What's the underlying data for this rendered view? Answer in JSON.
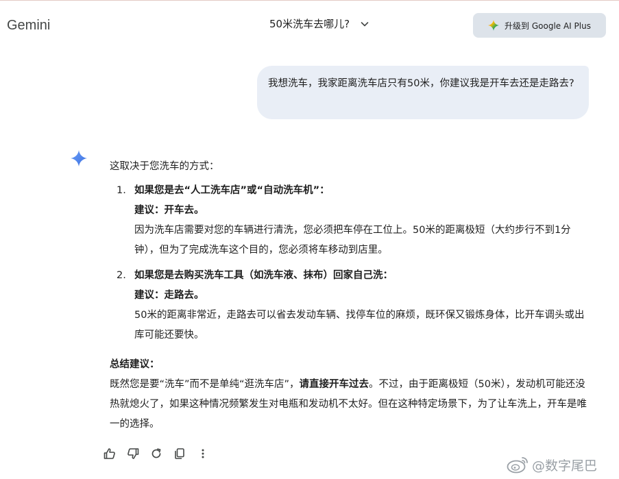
{
  "header": {
    "brand": "Gemini",
    "conversation_title": "50米洗车去哪儿?",
    "upgrade_label": "升级到 Google AI Plus"
  },
  "user_message": "我想洗车，我家距离洗车店只有50米，你建议我是开车去还是走路去?",
  "answer": {
    "intro": "这取决于您洗车的方式：",
    "items": [
      {
        "number": "1.",
        "heading": "如果您是去“人工洗车店”或“自动洗车机”：",
        "advice": "建议：开车去。",
        "detail": "因为洗车店需要对您的车辆进行清洗，您必须把车停在工位上。50米的距离极短（大约步行不到1分钟），但为了完成洗车这个目的，您必须将车移动到店里。"
      },
      {
        "number": "2.",
        "heading": "如果您是去购买洗车工具（如洗车液、抹布）回家自己洗：",
        "advice": "建议：走路去。",
        "detail": "50米的距离非常近，走路去可以省去发动车辆、找停车位的麻烦，既环保又锻炼身体，比开车调头或出库可能还要快。"
      }
    ],
    "summary_heading": "总结建议：",
    "summary_part1": "既然您是要“洗车”而不是单纯“逛洗车店”，",
    "summary_bold": "请直接开车过去",
    "summary_part2": "。不过，由于距离极短（50米），发动机可能还没热就熄火了，如果这种情况频繁发生对电瓶和发动机不太好。但在这种特定场景下，为了让车洗上，开车是唯一的选择。"
  },
  "actions": [
    "thumbs-up-icon",
    "thumbs-down-icon",
    "redo-icon",
    "copy-icon",
    "more-vertical-icon"
  ],
  "watermark": "@数字尾巴",
  "colors": {
    "user_bubble": "#e9eef6",
    "upgrade_button": "#dde3ea",
    "spark_blue": "#4285f4"
  }
}
